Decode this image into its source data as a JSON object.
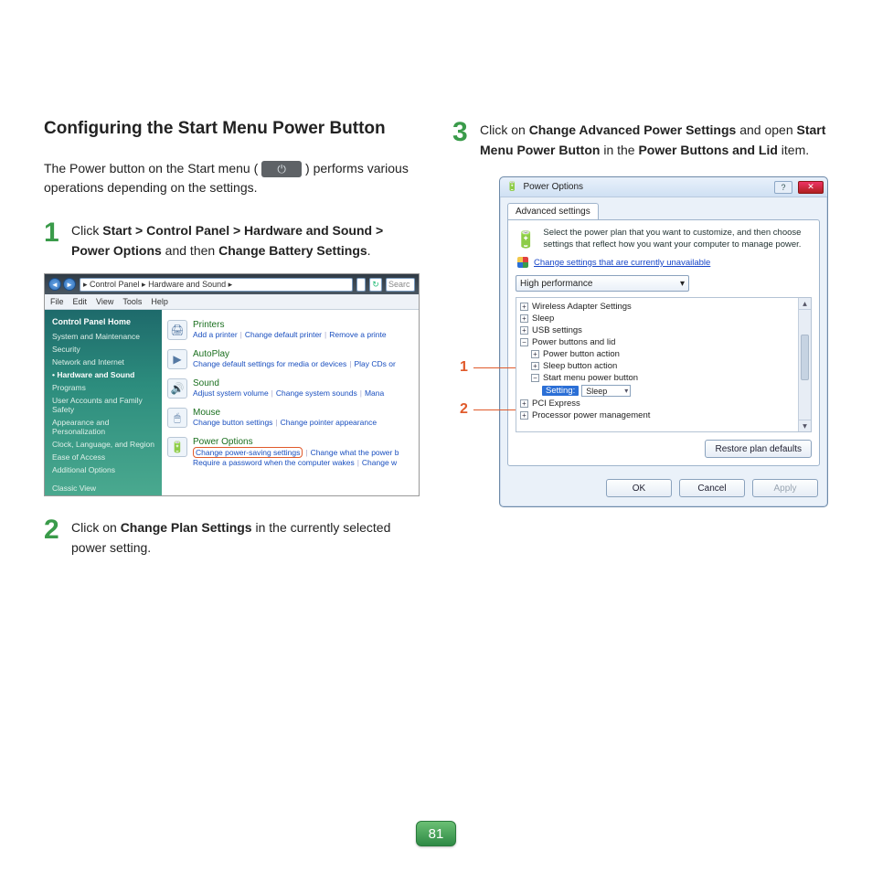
{
  "heading": "Configuring the Start Menu Power Button",
  "intro_a": "The Power button on the Start menu (",
  "intro_b": ") performs various operations depending on the settings.",
  "steps": {
    "n1": "1",
    "s1_a": "Click ",
    "s1_b": "Start > Control Panel > Hardware and Sound > Power Options",
    "s1_c": " and then ",
    "s1_d": "Change Battery Settings",
    "s1_e": ".",
    "n2": "2",
    "s2_a": "Click on ",
    "s2_b": "Change Plan Settings",
    "s2_c": " in the currently selected power setting.",
    "n3": "3",
    "s3_a": "Click on ",
    "s3_b": "Change Advanced Power Settings",
    "s3_c": " and open ",
    "s3_d": "Start Menu Power Button",
    "s3_e": " in the ",
    "s3_f": "Power Buttons and Lid",
    "s3_g": " item."
  },
  "shot1": {
    "crumb": "▸ Control Panel ▸ Hardware and Sound ▸",
    "search": "Searc",
    "menu": [
      "File",
      "Edit",
      "View",
      "Tools",
      "Help"
    ],
    "side_header": "Control Panel Home",
    "side_items": [
      "System and Maintenance",
      "Security",
      "Network and Internet",
      "Hardware and Sound",
      "Programs",
      "User Accounts and Family Safety",
      "Appearance and Personalization",
      "Clock, Language, and Region",
      "Ease of Access",
      "Additional Options"
    ],
    "side_footer": "Classic View",
    "cats": [
      {
        "icon": "🖨",
        "title": "Printers",
        "links": [
          "Add a printer",
          "Change default printer",
          "Remove a printe"
        ]
      },
      {
        "icon": "▶",
        "title": "AutoPlay",
        "links": [
          "Change default settings for media or devices",
          "Play CDs or"
        ]
      },
      {
        "icon": "🔊",
        "title": "Sound",
        "links": [
          "Adjust system volume",
          "Change system sounds",
          "Mana"
        ]
      },
      {
        "icon": "🖱",
        "title": "Mouse",
        "links": [
          "Change button settings",
          "Change pointer appearance"
        ]
      },
      {
        "icon": "🔋",
        "title": "Power Options",
        "links_hl": "Change power-saving settings",
        "links": [
          "Change what the power b"
        ],
        "line2": [
          "Require a password when the computer wakes",
          "Change w"
        ]
      }
    ]
  },
  "shot2": {
    "title": "Power Options",
    "tab": "Advanced settings",
    "desc": "Select the power plan that you want to customize, and then choose settings that reflect how you want your computer to manage power.",
    "link": "Change settings that are currently unavailable",
    "plan": "High performance",
    "tree": [
      "Wireless Adapter Settings",
      "Sleep",
      "USB settings",
      "Power buttons and lid",
      "Power button action",
      "Sleep button action",
      "Start menu power button",
      "Setting:",
      "Sleep",
      "PCI Express",
      "Processor power management"
    ],
    "restore": "Restore plan defaults",
    "ok": "OK",
    "cancel": "Cancel",
    "apply": "Apply"
  },
  "callouts": {
    "c1": "1",
    "c2": "2"
  },
  "page_number": "81"
}
